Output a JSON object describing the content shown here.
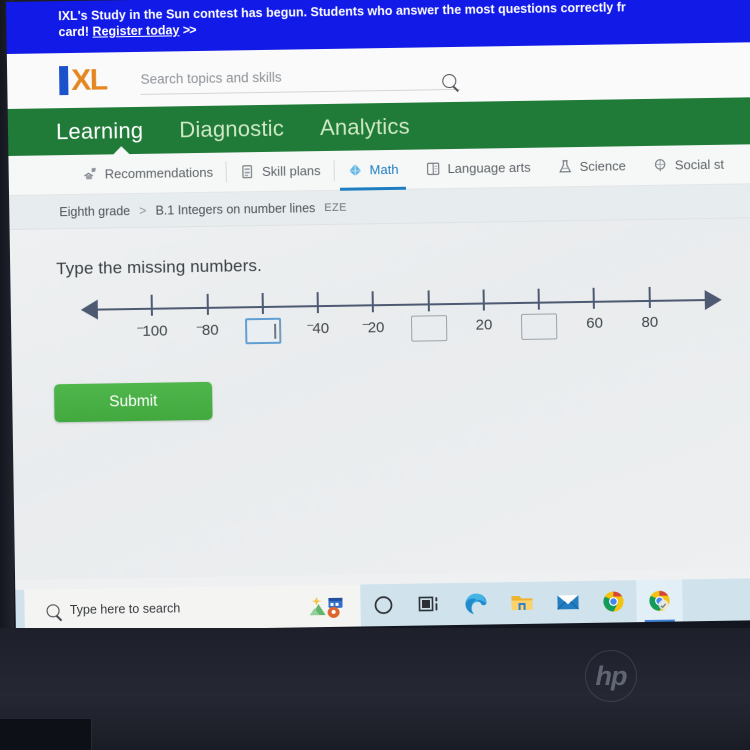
{
  "promo": {
    "text_before_link": "IXL's Study in the Sun contest has begun. Students who answer the most questions correctly fr",
    "text_line2_prefix": "card!",
    "link_label": "Register today",
    "chevrons": ">>"
  },
  "header": {
    "logo_letters": "XL",
    "search_placeholder": "Search topics and skills",
    "search_value": "",
    "search_icon": "magnifier-icon"
  },
  "green_nav": {
    "items": [
      {
        "label": "Learning",
        "active": true
      },
      {
        "label": "Diagnostic",
        "active": false
      },
      {
        "label": "Analytics",
        "active": false
      }
    ]
  },
  "subject_tabs": [
    {
      "label": "Recommendations",
      "icon": "recommendations-icon",
      "active": false
    },
    {
      "label": "Skill plans",
      "icon": "skill-plans-icon",
      "active": false
    },
    {
      "label": "Math",
      "icon": "math-diamond-icon",
      "active": true
    },
    {
      "label": "Language arts",
      "icon": "book-icon",
      "active": false
    },
    {
      "label": "Science",
      "icon": "flask-icon",
      "active": false
    },
    {
      "label": "Social st",
      "icon": "globe-icon",
      "active": false
    }
  ],
  "breadcrumb": {
    "grade": "Eighth grade",
    "separator": ">",
    "skill": "B.1 Integers on number lines",
    "code": "EZE"
  },
  "question": {
    "prompt": "Type the missing numbers.",
    "submit_label": "Submit"
  },
  "chart_data": {
    "type": "number-line",
    "title": "Type the missing numbers.",
    "tick_values": [
      -100,
      -80,
      -60,
      -40,
      -20,
      0,
      20,
      40,
      60,
      80
    ],
    "tick_labels": [
      "-100",
      "-80",
      "",
      "-40",
      "-20",
      "",
      "20",
      "",
      "60",
      "80"
    ],
    "negative_marker": "raised-minus",
    "blank_indices": [
      2,
      5,
      7
    ],
    "blank_answers": [
      "",
      "",
      ""
    ],
    "focused_blank_index": 2,
    "arrow_left": true,
    "arrow_right": true,
    "axis_color": "#4c5a73",
    "xlim": [
      -110,
      90
    ]
  },
  "taskbar": {
    "search_placeholder": "Type here to search",
    "search_icon": "magnifier-icon",
    "widget_icon": "weather-news-widget-icon",
    "icons": [
      {
        "name": "cortana-icon",
        "active": false
      },
      {
        "name": "task-view-icon",
        "active": false
      },
      {
        "name": "microsoft-edge-icon",
        "active": false
      },
      {
        "name": "file-explorer-icon",
        "active": false
      },
      {
        "name": "mail-icon",
        "active": false
      },
      {
        "name": "google-chrome-icon",
        "active": false
      },
      {
        "name": "chrome-app-icon",
        "active": true
      }
    ]
  },
  "device": {
    "brand_logo": "hp"
  },
  "colors": {
    "promo_blue": "#1019ef",
    "ixl_orange": "#e8861c",
    "ixl_blue": "#1952d0",
    "nav_green": "#1d7b36",
    "submit_green": "#4cb749",
    "active_tab_blue": "#1b7fc4",
    "focus_border": "#5f9fd6"
  }
}
